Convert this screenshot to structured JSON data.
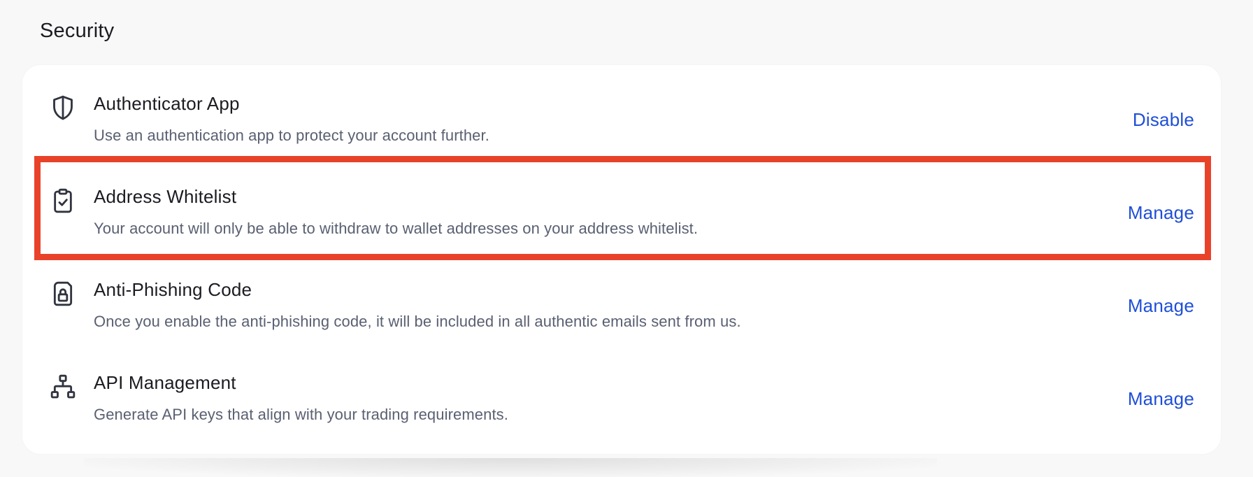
{
  "section": {
    "title": "Security"
  },
  "highlight_color": "#e8432a",
  "link_color": "#1f4fd8",
  "rows": [
    {
      "icon": "shield-icon",
      "title": "Authenticator App",
      "description": "Use an authentication app to protect your account further.",
      "action": "Disable"
    },
    {
      "icon": "clipboard-check-icon",
      "title": "Address Whitelist",
      "description": "Your account will only be able to withdraw to wallet addresses on your address whitelist.",
      "action": "Manage",
      "highlighted": true
    },
    {
      "icon": "lock-document-icon",
      "title": "Anti-Phishing Code",
      "description": "Once you enable the anti-phishing code, it will be included in all authentic emails sent from us.",
      "action": "Manage"
    },
    {
      "icon": "network-icon",
      "title": "API Management",
      "description": "Generate API keys that align with your trading requirements.",
      "action": "Manage"
    }
  ]
}
